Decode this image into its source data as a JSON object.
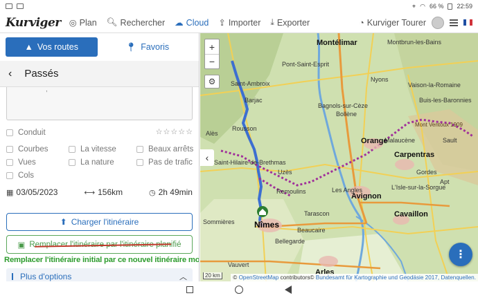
{
  "statusbar": {
    "battery": "66 %",
    "time": "22:59"
  },
  "nav": {
    "logo": "Kurviger",
    "plan": "Plan",
    "search": "Rechercher",
    "cloud": "Cloud",
    "import": "Importer",
    "export": "Exporter",
    "account": "Kurviger Tourer"
  },
  "colors": {
    "accent": "#2a6ebb",
    "replace_green": "#4a9a4a",
    "annotation_green": "#2e9c2e",
    "strike_red": "#c0392b",
    "route": "#3c6fd1",
    "route_alt": "#a0309a"
  },
  "tabs": {
    "routes": "Vos routes",
    "favorites": "Favoris"
  },
  "section": {
    "title": "Passés"
  },
  "filters": {
    "row1": {
      "label": "Conduit"
    },
    "items": [
      "Courbes",
      "La vitesse",
      "Beaux arrêts",
      "Vues",
      "La nature",
      "Pas de trafic",
      "Cols"
    ]
  },
  "stats": {
    "date": "03/05/2023",
    "distance": "156km",
    "duration": "2h 49min"
  },
  "buttons": {
    "load": "Charger l'itinéraire",
    "replace": "Remplacer l'itinéraire par l'itinéraire planifié",
    "more": "Plus d'options"
  },
  "annotation": "Remplacer l'itinéraire initial par ce nouvel itinéraire modifié",
  "map": {
    "zoom_in": "+",
    "zoom_out": "−",
    "scale": "20 km",
    "attribution_prefix": "©",
    "attribution_osm": "OpenStreetMap",
    "attribution_mid": "contributors©",
    "attribution_bkg": "Bundesamt für Kartographie und Geodäsie 2017,",
    "attribution_data": "Datenquellen.",
    "labels": [
      {
        "text": "Montélimar",
        "cls": "city"
      },
      {
        "text": "Montbrun-les-Bains",
        "cls": ""
      },
      {
        "text": "Nyons",
        "cls": ""
      },
      {
        "text": "Vaison-la-Romaine",
        "cls": ""
      },
      {
        "text": "Mont Ventoux 1909",
        "cls": "elev"
      },
      {
        "text": "Orange",
        "cls": "city"
      },
      {
        "text": "Carpentras",
        "cls": "city"
      },
      {
        "text": "Bagnols-sur-Cèze",
        "cls": ""
      },
      {
        "text": "Uzès",
        "cls": ""
      },
      {
        "text": "Avignon",
        "cls": "city"
      },
      {
        "text": "Nîmes",
        "cls": "bigcity"
      },
      {
        "text": "Cavaillon",
        "cls": "city"
      },
      {
        "text": "Arles",
        "cls": "city"
      },
      {
        "text": "Beaucaire",
        "cls": ""
      },
      {
        "text": "Tarascon",
        "cls": ""
      },
      {
        "text": "Saint-Hilaire-de-Brethmas",
        "cls": ""
      },
      {
        "text": "Alès",
        "cls": ""
      },
      {
        "text": "Bollène",
        "cls": ""
      },
      {
        "text": "Pont-Saint-Esprit",
        "cls": ""
      },
      {
        "text": "Rousson",
        "cls": ""
      },
      {
        "text": "Sommières",
        "cls": ""
      },
      {
        "text": "Vauvert",
        "cls": ""
      },
      {
        "text": "Remoulins",
        "cls": ""
      },
      {
        "text": "Sault",
        "cls": ""
      },
      {
        "text": "Apt",
        "cls": ""
      },
      {
        "text": "Buis-les-Baronnies",
        "cls": ""
      },
      {
        "text": "Malaucène",
        "cls": ""
      },
      {
        "text": "Saint-Ambroix",
        "cls": ""
      },
      {
        "text": "Barjac",
        "cls": ""
      },
      {
        "text": "Les Angles",
        "cls": ""
      },
      {
        "text": "L'Isle-sur-la-Sorgue",
        "cls": ""
      },
      {
        "text": "Gordes",
        "cls": ""
      },
      {
        "text": "Bellegarde",
        "cls": ""
      }
    ]
  }
}
